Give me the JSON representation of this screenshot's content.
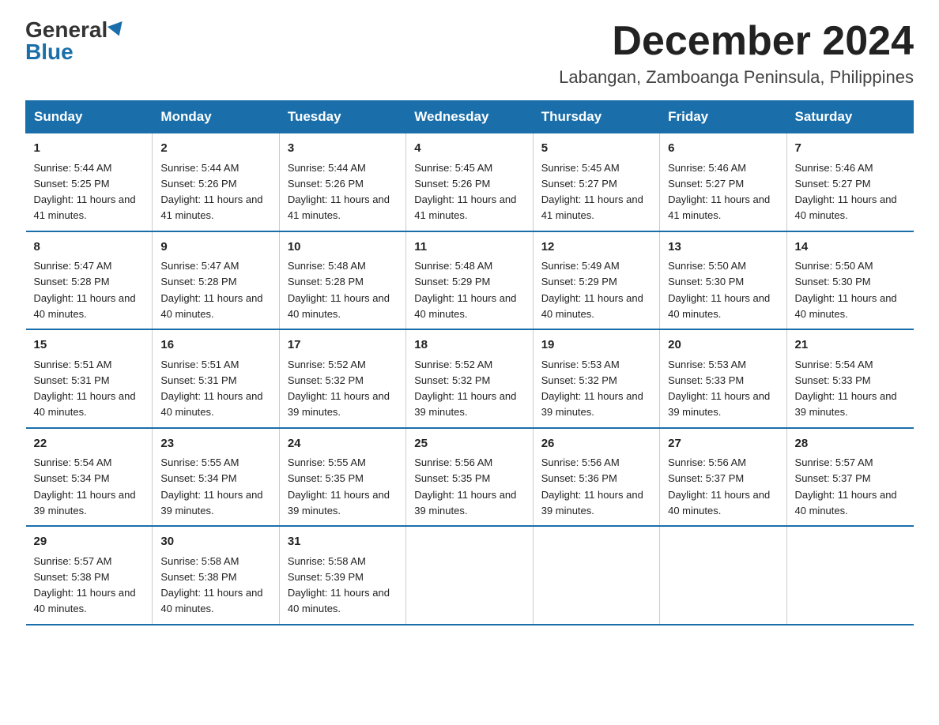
{
  "logo": {
    "general": "General",
    "blue": "Blue"
  },
  "title": "December 2024",
  "location": "Labangan, Zamboanga Peninsula, Philippines",
  "days_of_week": [
    "Sunday",
    "Monday",
    "Tuesday",
    "Wednesday",
    "Thursday",
    "Friday",
    "Saturday"
  ],
  "weeks": [
    [
      {
        "day": "1",
        "sunrise": "5:44 AM",
        "sunset": "5:25 PM",
        "daylight": "11 hours and 41 minutes."
      },
      {
        "day": "2",
        "sunrise": "5:44 AM",
        "sunset": "5:26 PM",
        "daylight": "11 hours and 41 minutes."
      },
      {
        "day": "3",
        "sunrise": "5:44 AM",
        "sunset": "5:26 PM",
        "daylight": "11 hours and 41 minutes."
      },
      {
        "day": "4",
        "sunrise": "5:45 AM",
        "sunset": "5:26 PM",
        "daylight": "11 hours and 41 minutes."
      },
      {
        "day": "5",
        "sunrise": "5:45 AM",
        "sunset": "5:27 PM",
        "daylight": "11 hours and 41 minutes."
      },
      {
        "day": "6",
        "sunrise": "5:46 AM",
        "sunset": "5:27 PM",
        "daylight": "11 hours and 41 minutes."
      },
      {
        "day": "7",
        "sunrise": "5:46 AM",
        "sunset": "5:27 PM",
        "daylight": "11 hours and 40 minutes."
      }
    ],
    [
      {
        "day": "8",
        "sunrise": "5:47 AM",
        "sunset": "5:28 PM",
        "daylight": "11 hours and 40 minutes."
      },
      {
        "day": "9",
        "sunrise": "5:47 AM",
        "sunset": "5:28 PM",
        "daylight": "11 hours and 40 minutes."
      },
      {
        "day": "10",
        "sunrise": "5:48 AM",
        "sunset": "5:28 PM",
        "daylight": "11 hours and 40 minutes."
      },
      {
        "day": "11",
        "sunrise": "5:48 AM",
        "sunset": "5:29 PM",
        "daylight": "11 hours and 40 minutes."
      },
      {
        "day": "12",
        "sunrise": "5:49 AM",
        "sunset": "5:29 PM",
        "daylight": "11 hours and 40 minutes."
      },
      {
        "day": "13",
        "sunrise": "5:50 AM",
        "sunset": "5:30 PM",
        "daylight": "11 hours and 40 minutes."
      },
      {
        "day": "14",
        "sunrise": "5:50 AM",
        "sunset": "5:30 PM",
        "daylight": "11 hours and 40 minutes."
      }
    ],
    [
      {
        "day": "15",
        "sunrise": "5:51 AM",
        "sunset": "5:31 PM",
        "daylight": "11 hours and 40 minutes."
      },
      {
        "day": "16",
        "sunrise": "5:51 AM",
        "sunset": "5:31 PM",
        "daylight": "11 hours and 40 minutes."
      },
      {
        "day": "17",
        "sunrise": "5:52 AM",
        "sunset": "5:32 PM",
        "daylight": "11 hours and 39 minutes."
      },
      {
        "day": "18",
        "sunrise": "5:52 AM",
        "sunset": "5:32 PM",
        "daylight": "11 hours and 39 minutes."
      },
      {
        "day": "19",
        "sunrise": "5:53 AM",
        "sunset": "5:32 PM",
        "daylight": "11 hours and 39 minutes."
      },
      {
        "day": "20",
        "sunrise": "5:53 AM",
        "sunset": "5:33 PM",
        "daylight": "11 hours and 39 minutes."
      },
      {
        "day": "21",
        "sunrise": "5:54 AM",
        "sunset": "5:33 PM",
        "daylight": "11 hours and 39 minutes."
      }
    ],
    [
      {
        "day": "22",
        "sunrise": "5:54 AM",
        "sunset": "5:34 PM",
        "daylight": "11 hours and 39 minutes."
      },
      {
        "day": "23",
        "sunrise": "5:55 AM",
        "sunset": "5:34 PM",
        "daylight": "11 hours and 39 minutes."
      },
      {
        "day": "24",
        "sunrise": "5:55 AM",
        "sunset": "5:35 PM",
        "daylight": "11 hours and 39 minutes."
      },
      {
        "day": "25",
        "sunrise": "5:56 AM",
        "sunset": "5:35 PM",
        "daylight": "11 hours and 39 minutes."
      },
      {
        "day": "26",
        "sunrise": "5:56 AM",
        "sunset": "5:36 PM",
        "daylight": "11 hours and 39 minutes."
      },
      {
        "day": "27",
        "sunrise": "5:56 AM",
        "sunset": "5:37 PM",
        "daylight": "11 hours and 40 minutes."
      },
      {
        "day": "28",
        "sunrise": "5:57 AM",
        "sunset": "5:37 PM",
        "daylight": "11 hours and 40 minutes."
      }
    ],
    [
      {
        "day": "29",
        "sunrise": "5:57 AM",
        "sunset": "5:38 PM",
        "daylight": "11 hours and 40 minutes."
      },
      {
        "day": "30",
        "sunrise": "5:58 AM",
        "sunset": "5:38 PM",
        "daylight": "11 hours and 40 minutes."
      },
      {
        "day": "31",
        "sunrise": "5:58 AM",
        "sunset": "5:39 PM",
        "daylight": "11 hours and 40 minutes."
      },
      null,
      null,
      null,
      null
    ]
  ]
}
